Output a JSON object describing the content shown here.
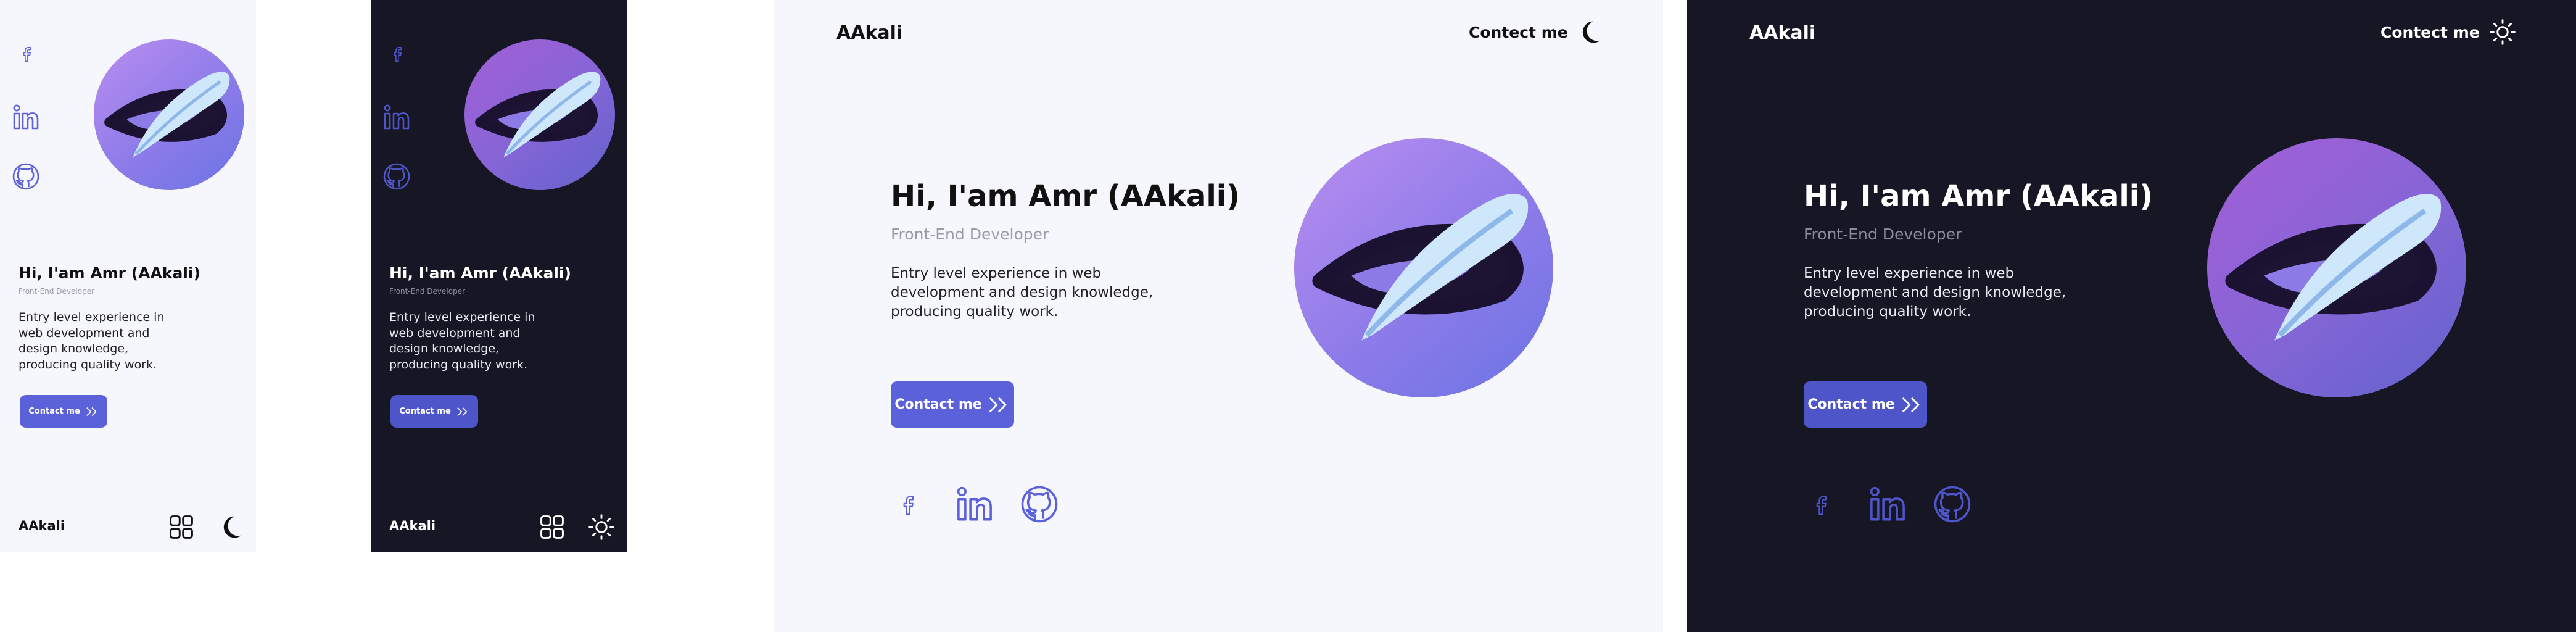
{
  "colors": {
    "light_bg": "#f6f6fd",
    "dark_bg": "#161624",
    "accent": "#5b61d9",
    "social_icon": "#5b61d9",
    "subtitle": "#9a9aa8"
  },
  "brand": "AAkali",
  "nav": {
    "contact_link": "Contect me",
    "theme_toggle_light_icon": "moon-icon",
    "theme_toggle_dark_icon": "sun-icon",
    "menu_icon": "apps-grid-icon"
  },
  "hero": {
    "title": "Hi, I'am Amr (AAkali)",
    "subtitle": "Front-End Developer",
    "description": "Entry level experience in web development and design knowledge, producing quality work.",
    "button_label": "Contact me",
    "button_icon": "double-chevron-right-icon",
    "avatar_icon": "feather-logo-icon"
  },
  "social": [
    {
      "name": "facebook",
      "icon": "facebook-icon"
    },
    {
      "name": "linkedin",
      "icon": "linkedin-icon"
    },
    {
      "name": "github",
      "icon": "github-icon"
    }
  ]
}
